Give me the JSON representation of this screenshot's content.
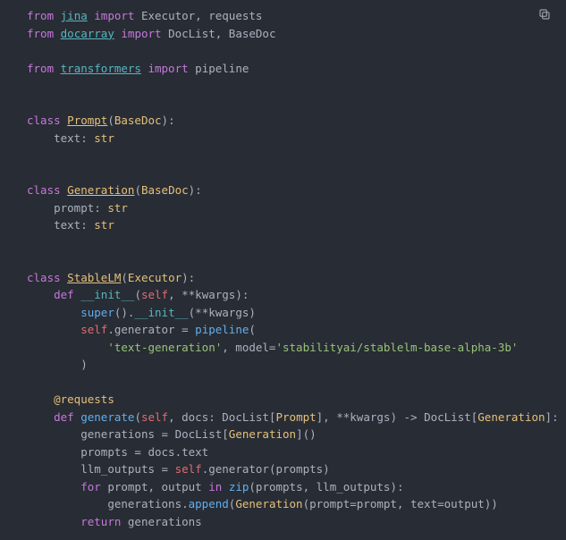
{
  "copy_button_name": "copy-icon",
  "code": {
    "l1": {
      "from": "from",
      "sp": " ",
      "mod": "jina",
      "sp2": " ",
      "imp": "import",
      "sp3": " ",
      "ids": "Executor, requests"
    },
    "l2": {
      "from": "from",
      "sp": " ",
      "mod": "docarray",
      "sp2": " ",
      "imp": "import",
      "sp3": " ",
      "ids": "DocList, BaseDoc"
    },
    "l4": {
      "from": "from",
      "sp": " ",
      "mod": "transformers",
      "sp2": " ",
      "imp": "import",
      "sp3": " ",
      "ids": "pipeline"
    },
    "l8": {
      "cls": "class",
      "sp": " ",
      "name": "Prompt",
      "paren_open": "(",
      "base": "BaseDoc",
      "paren_close": "):"
    },
    "l9": {
      "indent": "    ",
      "fld": "text",
      "colon": ": ",
      "typ": "str"
    },
    "l13": {
      "cls": "class",
      "sp": " ",
      "name": "Generation",
      "paren_open": "(",
      "base": "BaseDoc",
      "paren_close": "):"
    },
    "l14": {
      "indent": "    ",
      "fld": "prompt",
      "colon": ": ",
      "typ": "str"
    },
    "l15": {
      "indent": "    ",
      "fld": "text",
      "colon": ": ",
      "typ": "str"
    },
    "l19": {
      "cls": "class",
      "sp": " ",
      "name": "StableLM",
      "paren_open": "(",
      "base": "Executor",
      "paren_close": "):"
    },
    "l20": {
      "indent": "    ",
      "def": "def",
      "sp": " ",
      "fn": "__init__",
      "open": "(",
      "self": "self",
      "rest": ", **kwargs):"
    },
    "l21": {
      "indent": "        ",
      "sup": "super",
      "p": "().",
      "dund": "__init__",
      "args": "(**kwargs)"
    },
    "l22": {
      "indent": "        ",
      "self": "self",
      "dot": ".generator = ",
      "fn": "pipeline",
      "open": "("
    },
    "l23": {
      "indent": "            ",
      "s1": "'text-generation'",
      "mid": ", model=",
      "s2": "'stabilityai/stablelm-base-alpha-3b'"
    },
    "l24": {
      "indent": "        ",
      "close": ")"
    },
    "l27": {
      "indent": "    ",
      "dec": "@requests"
    },
    "l28": {
      "indent": "    ",
      "def": "def",
      "sp": " ",
      "fn": "generate",
      "open": "(",
      "self": "self",
      "mid1": ", docs: DocList[",
      "t1": "Prompt",
      "mid2": "], **kwargs) -> DocList[",
      "t2": "Generation",
      "mid3": "]:"
    },
    "l29": {
      "indent": "        ",
      "lhs": "generations = DocList[",
      "t": "Generation",
      "rhs": "]()"
    },
    "l30": {
      "indent": "        ",
      "txt": "prompts = docs.text"
    },
    "l31": {
      "indent": "        ",
      "a": "llm_outputs = ",
      "self": "self",
      "b": ".generator(prompts)"
    },
    "l32": {
      "indent": "        ",
      "for": "for",
      "a": " prompt, output ",
      "in": "in",
      "sp": " ",
      "fn": "zip",
      "b": "(prompts, llm_outputs):"
    },
    "l33": {
      "indent": "            ",
      "a": "generations.",
      "fn": "append",
      "b": "(",
      "cls": "Generation",
      "c": "(prompt=prompt, text=output))"
    },
    "l34": {
      "indent": "        ",
      "ret": "return",
      "sp": " ",
      "v": "generations"
    }
  }
}
